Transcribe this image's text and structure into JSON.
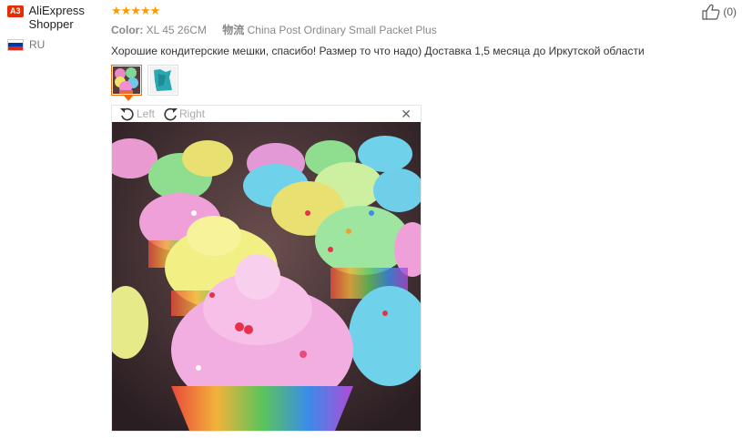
{
  "user": {
    "badge": "A3",
    "name": "AliExpress Shopper",
    "country_code": "RU"
  },
  "review": {
    "rating": 5,
    "color_label": "Color:",
    "color_value": "XL 45 26CM",
    "shipping_label": "物流",
    "shipping_value": "China Post Ordinary Small Packet Plus",
    "text": "Хорошие кондитерские мешки, спасибо! Размер то что надо) Доставка 1,5 месяца до Иркутской области"
  },
  "thumbnails": [
    {
      "icon": "cupcake-photo",
      "active": true
    },
    {
      "icon": "teal-bag-photo",
      "active": false
    }
  ],
  "viewer": {
    "rotate_left_label": "Left",
    "rotate_right_label": "Right",
    "close_icon": "close-icon"
  },
  "likes": {
    "count_text": "(0)"
  },
  "colors": {
    "star": "#ff9a00",
    "badge": "#e62e04",
    "active_thumb": "#ff6600"
  }
}
